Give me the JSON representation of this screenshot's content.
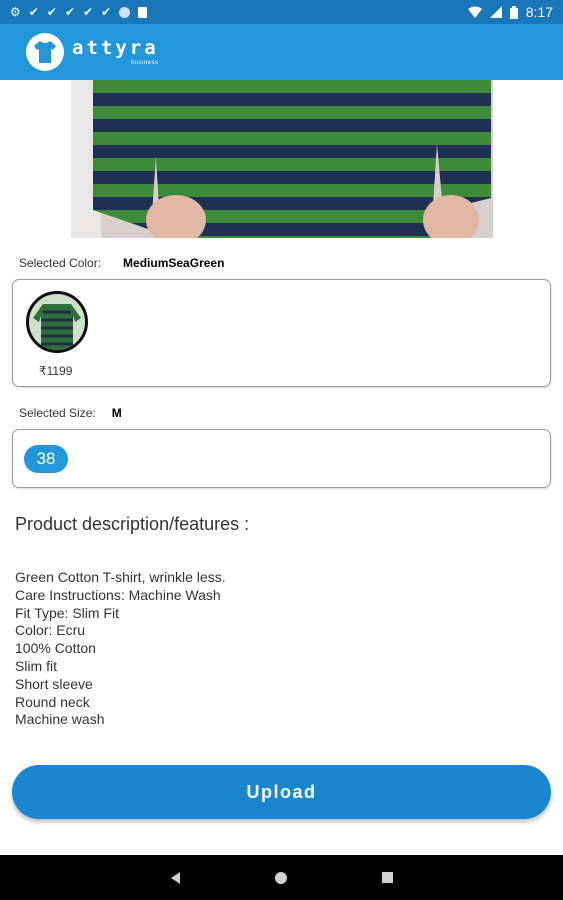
{
  "status_bar": {
    "time": "8:17",
    "icons": [
      "settings-icon",
      "check-icon",
      "check-icon",
      "check-icon",
      "check-icon",
      "check-icon",
      "circle-icon",
      "sdcard-icon"
    ],
    "right_icons": [
      "wifi-icon",
      "signal-icon",
      "battery-icon"
    ]
  },
  "app_bar": {
    "brand_name": "attyra",
    "brand_sub": "business"
  },
  "color_section": {
    "label": "Selected Color:",
    "value": "MediumSeaGreen",
    "price": "₹1199"
  },
  "size_section": {
    "label": "Selected Size:",
    "value": "M",
    "chip": "38"
  },
  "description": {
    "heading": "Product description/features :",
    "lines": [
      "Green Cotton T-shirt, wrinkle less.",
      "Care Instructions: Machine Wash",
      "Fit Type: Slim Fit",
      "Color: Ecru",
      "100% Cotton",
      "Slim fit",
      "Short sleeve",
      "Round neck",
      "Machine wash"
    ]
  },
  "upload_button": {
    "label": "Upload"
  },
  "nav_bar": {
    "icons": [
      "back-icon",
      "home-icon",
      "recents-icon"
    ]
  }
}
